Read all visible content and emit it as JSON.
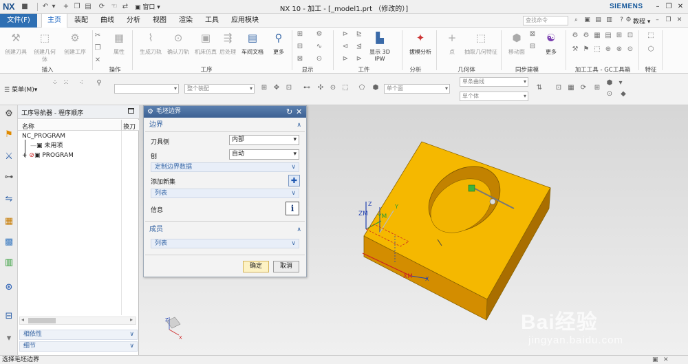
{
  "app": {
    "logo": "NX",
    "window_menu": "窗口",
    "title": "NX 10 - 加工 - [_model1.prt （修改的）]",
    "brand": "SIEMENS"
  },
  "tabs": [
    {
      "label": "文件(F)"
    },
    {
      "label": "主页"
    },
    {
      "label": "装配"
    },
    {
      "label": "曲线"
    },
    {
      "label": "分析"
    },
    {
      "label": "视图"
    },
    {
      "label": "渲染"
    },
    {
      "label": "工具"
    },
    {
      "label": "应用模块"
    }
  ],
  "active_tab": "主页",
  "search": {
    "placeholder": "查找命令"
  },
  "tutorial_label": "教程",
  "ribbon": {
    "buttons": [
      {
        "label": "创建刀具",
        "icon": "create-tool-icon"
      },
      {
        "label": "创建几何体",
        "icon": "create-geometry-icon"
      },
      {
        "label": "创建工序",
        "icon": "create-operation-icon"
      },
      {
        "label": "属性",
        "icon": "properties-icon"
      },
      {
        "label": "生成刀轨",
        "icon": "generate-toolpath-icon"
      },
      {
        "label": "确认刀轨",
        "icon": "verify-toolpath-icon"
      },
      {
        "label": "机床仿真",
        "icon": "machine-simulation-icon"
      },
      {
        "label": "后处理",
        "icon": "postprocess-icon"
      },
      {
        "label": "车间文档",
        "icon": "shop-documentation-icon"
      },
      {
        "label": "更多",
        "icon": "more-icon"
      },
      {
        "label": "显示 3D IPW",
        "icon": "show-3d-ipw-icon"
      },
      {
        "label": "拔模分析",
        "icon": "draft-analysis-icon"
      },
      {
        "label": "点",
        "icon": "point-icon"
      },
      {
        "label": "抽取几何特征",
        "icon": "extract-geometry-icon"
      },
      {
        "label": "移动面",
        "icon": "move-face-icon"
      },
      {
        "label": "更多",
        "icon": "more-icon"
      }
    ],
    "groups": [
      {
        "label": "插入"
      },
      {
        "label": "操作"
      },
      {
        "label": "工序"
      },
      {
        "label": "显示"
      },
      {
        "label": "工件"
      },
      {
        "label": "分析"
      },
      {
        "label": "几何体"
      },
      {
        "label": "同步建模"
      },
      {
        "label": "加工工具 - GC工具箱"
      },
      {
        "label": "特征"
      }
    ]
  },
  "toolbar2": {
    "menu_label": "菜单(M)",
    "filter_placeholder": "整个装配",
    "face_filter": "单个面",
    "curve_filter": "单条曲线",
    "body_filter": "单个体"
  },
  "navigator": {
    "title": "工序导航器 - 程序顺序",
    "columns": [
      "名称",
      "换刀"
    ],
    "items": [
      {
        "label": "NC_PROGRAM"
      },
      {
        "label": "未用项"
      },
      {
        "label": "PROGRAM"
      }
    ],
    "panels": [
      {
        "label": "相依性"
      },
      {
        "label": "细节"
      }
    ]
  },
  "dialog": {
    "title": "毛坯边界",
    "section_boundary": "边界",
    "tool_side_label": "刀具侧",
    "tool_side_value": "内部",
    "plane_label": "刨",
    "plane_value": "自动",
    "custom_boundary": "定制边界数据",
    "add_new_set": "添加新集",
    "list_label": "列表",
    "info_label": "信息",
    "section_members": "成员",
    "members_list": "列表",
    "ok": "确定",
    "cancel": "取消"
  },
  "viewport": {
    "axis_zm": "ZM",
    "axis_ym": "YM",
    "axis_xm": "XM",
    "axis_z": "Z",
    "axis_y": "Y",
    "axis_x": "X",
    "triad_x": "X",
    "triad_z": "Z"
  },
  "status": {
    "message": "选择毛坯边界"
  },
  "watermark": {
    "text": "Bai经验",
    "url": "jingyan.baidu.com"
  },
  "colors": {
    "accent": "#2e6fb3",
    "model_top": "#f5b800",
    "model_front": "#cf8a00",
    "model_side": "#a96e00",
    "tool_marker": "#3cb43c"
  }
}
